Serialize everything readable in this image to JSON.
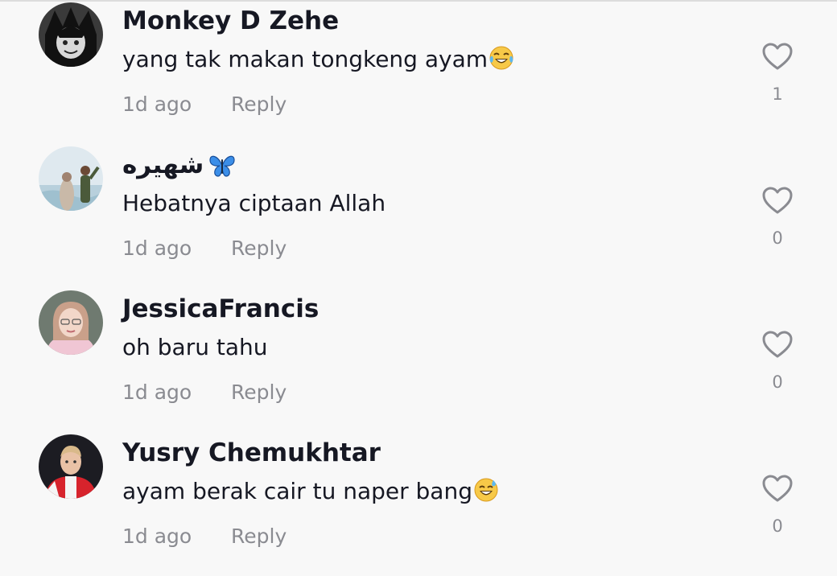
{
  "comments": [
    {
      "username": "Monkey D Zehe",
      "text": "yang tak makan tongkeng ayam",
      "text_emoji": "tears-of-joy-emoji",
      "time": "1d ago",
      "reply_label": "Reply",
      "likes": "1"
    },
    {
      "username": "شهيره",
      "username_emoji": "butterfly-emoji",
      "text": "Hebatnya ciptaan Allah",
      "time": "1d ago",
      "reply_label": "Reply",
      "likes": "0"
    },
    {
      "username": "JessicaFrancis",
      "text": "oh baru tahu",
      "time": "1d ago",
      "reply_label": "Reply",
      "likes": "0"
    },
    {
      "username": "Yusry Chemukhtar",
      "text": "ayam berak cair tu naper bang",
      "text_emoji": "sweat-smile-emoji",
      "time": "1d ago",
      "reply_label": "Reply",
      "likes": "0"
    }
  ],
  "colors": {
    "background": "#f8f8f8",
    "primary_text": "#161823",
    "secondary_text": "#8a8b91"
  }
}
